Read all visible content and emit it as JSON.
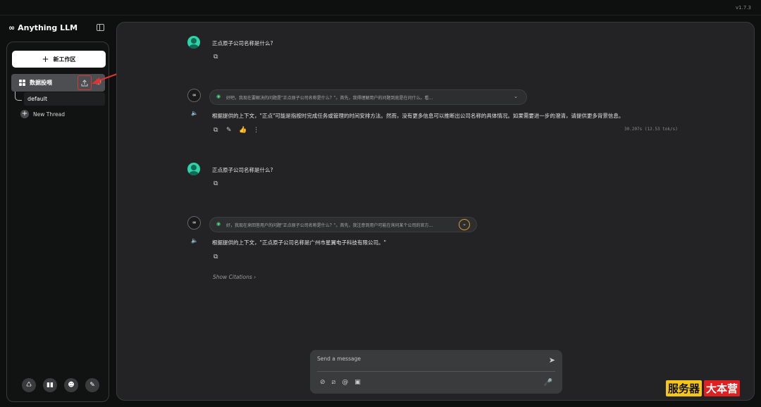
{
  "app": {
    "version": "v1.7.3",
    "brand": "Anything LLM",
    "brand_logo": "∞"
  },
  "sidebar": {
    "new_workspace": "新工作区",
    "workspace_name": "数据投喂",
    "threads": [
      "default"
    ],
    "new_thread": "New Thread",
    "footer_icons": [
      "community-icon",
      "docs-icon",
      "discord-icon",
      "settings-icon"
    ]
  },
  "chat": {
    "messages": [
      {
        "role": "user",
        "text": "正点原子公司名称是什么?"
      },
      {
        "role": "assistant",
        "thought": "好吧，我现在要解决的问题是\"正点原子公司名称是什么？\"。首先，我得理解用户的问题到底是在问什么。看...",
        "text": "根据提供的上下文，\"正点\"可能是指按时完成任务或管理的时间安排方法。然而，没有更多信息可以推断出公司名称的具体情况。如果需要进一步的澄清，请提供更多背景信息。",
        "stats": "30.207s (12.53 tok/s)"
      },
      {
        "role": "user",
        "text": "正点原子公司名称是什么?"
      },
      {
        "role": "assistant",
        "thought": "好，我现在来回答用户的问题\"正点原子公司名称是什么？\"。首先，我注意到用户可能在询问某个公司的官方...",
        "text": "根据提供的上下文，\"正点原子公司名称是广州市星翼电子科技有限公司。\"",
        "citations": "Show Citations"
      }
    ]
  },
  "composer": {
    "placeholder": "Send a message"
  },
  "watermark": {
    "part1": "服务器",
    "part2": "大本营"
  },
  "colors": {
    "accent_user": "#2dd4a8",
    "highlight_red": "#e03434",
    "highlight_orange": "#e0a020"
  }
}
